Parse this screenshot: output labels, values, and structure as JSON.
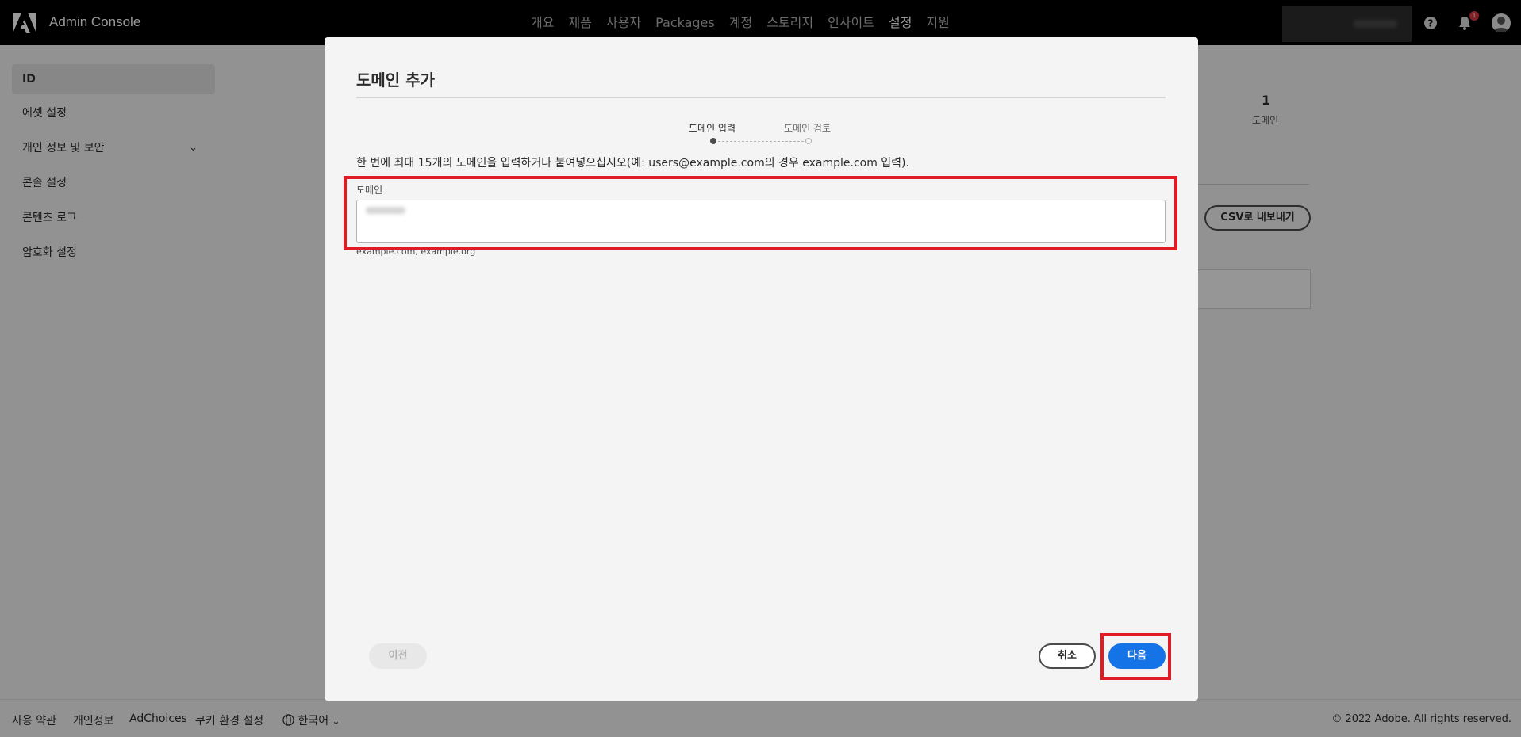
{
  "app": {
    "title": "Admin Console"
  },
  "nav": {
    "items": [
      {
        "label": "개요",
        "active": false
      },
      {
        "label": "제품",
        "active": false
      },
      {
        "label": "사용자",
        "active": false
      },
      {
        "label": "Packages",
        "active": false
      },
      {
        "label": "계정",
        "active": false
      },
      {
        "label": "스토리지",
        "active": false
      },
      {
        "label": "인사이트",
        "active": false
      },
      {
        "label": "설정",
        "active": true
      },
      {
        "label": "지원",
        "active": false
      }
    ]
  },
  "header": {
    "notification_count": "1",
    "icons": [
      "help-icon",
      "bell-icon",
      "avatar-icon"
    ]
  },
  "sidebar": {
    "items": [
      {
        "label": "ID",
        "active": true
      },
      {
        "label": "에셋 설정",
        "active": false
      },
      {
        "label": "개인 정보 및 보안",
        "active": false,
        "expandable": true
      },
      {
        "label": "콘솔 설정",
        "active": false
      },
      {
        "label": "콘텐츠 로그",
        "active": false
      },
      {
        "label": "암호화 설정",
        "active": false
      }
    ]
  },
  "background": {
    "stat_value": "1",
    "stat_label": "도메인",
    "export_csv_label": "CSV로 내보내기"
  },
  "modal": {
    "title": "도메인 추가",
    "steps": [
      {
        "label": "도메인 입력",
        "state": "current"
      },
      {
        "label": "도메인 검토",
        "state": "upcoming"
      }
    ],
    "instruction": "한 번에 최대 15개의 도메인을 입력하거나 붙여넣으십시오(예: users@example.com의 경우 example.com 입력).",
    "field_label": "도메인",
    "field_value": "",
    "hint": "example.com, example.org",
    "prev_label": "이전",
    "cancel_label": "취소",
    "next_label": "다음"
  },
  "footer": {
    "links": [
      "사용 약관",
      "개인정보",
      "AdChoices",
      "쿠키 환경 설정"
    ],
    "language": "한국어",
    "copyright": "© 2022 Adobe. All rights reserved."
  },
  "colors": {
    "topbar": "#000000",
    "accent": "#1473e6",
    "highlight": "#e01b24",
    "badge": "#d7373f"
  }
}
